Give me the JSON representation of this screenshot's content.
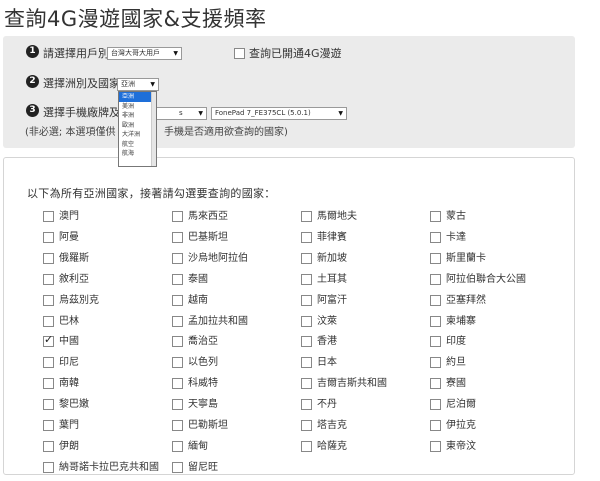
{
  "page": {
    "title": "查詢4G漫遊國家&支援頻率"
  },
  "filters": {
    "step1": {
      "number": "1",
      "label": "請選擇用戶別",
      "value": "台灣大哥大用戶",
      "checkbox_label": "查詢已開通4G漫遊"
    },
    "step2": {
      "number": "2",
      "label": "選擇洲別及國家",
      "value": "亞洲",
      "options": [
        "亞洲",
        "美洲",
        "非洲",
        "歐洲",
        "大洋洲",
        "航空",
        "航海"
      ]
    },
    "step3": {
      "number": "3",
      "label": "選擇手機廠牌及",
      "brand_value": "s",
      "model_value": "FonePad 7_FE375CL (5.0.1)",
      "note_left": "(非必選; 本選項僅供",
      "note_right": "手機是否適用欲查詢的國家)"
    }
  },
  "countries": {
    "heading": "以下為所有亞洲國家，接著請勾選要查詢的國家：",
    "items": [
      {
        "name": "澳門",
        "checked": false
      },
      {
        "name": "馬來西亞",
        "checked": false
      },
      {
        "name": "馬爾地夫",
        "checked": false
      },
      {
        "name": "蒙古",
        "checked": false
      },
      {
        "name": "阿曼",
        "checked": false
      },
      {
        "name": "巴基斯坦",
        "checked": false
      },
      {
        "name": "菲律賓",
        "checked": false
      },
      {
        "name": "卡達",
        "checked": false
      },
      {
        "name": "俄羅斯",
        "checked": false
      },
      {
        "name": "沙烏地阿拉伯",
        "checked": false
      },
      {
        "name": "新加坡",
        "checked": false
      },
      {
        "name": "斯里蘭卡",
        "checked": false
      },
      {
        "name": "敘利亞",
        "checked": false
      },
      {
        "name": "泰國",
        "checked": false
      },
      {
        "name": "土耳其",
        "checked": false
      },
      {
        "name": "阿拉伯聯合大公國",
        "checked": false
      },
      {
        "name": "烏茲別克",
        "checked": false
      },
      {
        "name": "越南",
        "checked": false
      },
      {
        "name": "阿富汗",
        "checked": false
      },
      {
        "name": "亞塞拜然",
        "checked": false
      },
      {
        "name": "巴林",
        "checked": false
      },
      {
        "name": "孟加拉共和國",
        "checked": false
      },
      {
        "name": "汶萊",
        "checked": false
      },
      {
        "name": "柬埔寨",
        "checked": false
      },
      {
        "name": "中國",
        "checked": true
      },
      {
        "name": "喬治亞",
        "checked": false
      },
      {
        "name": "香港",
        "checked": false
      },
      {
        "name": "印度",
        "checked": false
      },
      {
        "name": "印尼",
        "checked": false
      },
      {
        "name": "以色列",
        "checked": false
      },
      {
        "name": "日本",
        "checked": false
      },
      {
        "name": "約旦",
        "checked": false
      },
      {
        "name": "南韓",
        "checked": false
      },
      {
        "name": "科威特",
        "checked": false
      },
      {
        "name": "吉爾吉斯共和國",
        "checked": false
      },
      {
        "name": "寮國",
        "checked": false
      },
      {
        "name": "黎巴嫩",
        "checked": false
      },
      {
        "name": "天寧島",
        "checked": false
      },
      {
        "name": "不丹",
        "checked": false
      },
      {
        "name": "尼泊爾",
        "checked": false
      },
      {
        "name": "葉門",
        "checked": false
      },
      {
        "name": "巴勒斯坦",
        "checked": false
      },
      {
        "name": "塔吉克",
        "checked": false
      },
      {
        "name": "伊拉克",
        "checked": false
      },
      {
        "name": "伊朗",
        "checked": false
      },
      {
        "name": "緬甸",
        "checked": false
      },
      {
        "name": "哈薩克",
        "checked": false
      },
      {
        "name": "東帝汶",
        "checked": false
      },
      {
        "name": "納哥諾卡拉巴克共和國",
        "checked": false
      },
      {
        "name": "留尼旺",
        "checked": false
      }
    ]
  }
}
